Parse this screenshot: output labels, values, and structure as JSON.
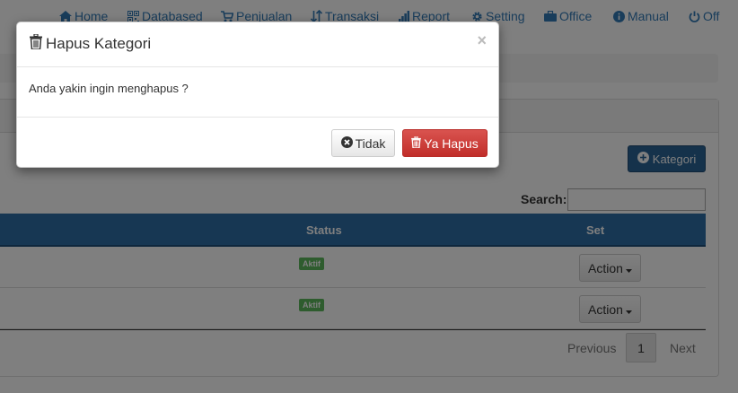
{
  "nav": {
    "items": [
      {
        "label": "Home",
        "icon": "home-icon"
      },
      {
        "label": "Databased",
        "icon": "qrcode-icon"
      },
      {
        "label": "Penjualan",
        "icon": "cart-icon"
      },
      {
        "label": "Transaksi",
        "icon": "sort-icon"
      },
      {
        "label": "Report",
        "icon": "bar-chart-icon"
      },
      {
        "label": "Setting",
        "icon": "gear-icon"
      },
      {
        "label": "Office",
        "icon": "briefcase-icon"
      },
      {
        "label": "Manual",
        "icon": "info-icon"
      },
      {
        "label": "Off",
        "icon": "power-icon"
      }
    ]
  },
  "page": {
    "add_button_label": "Kategori",
    "search_label": "Search:",
    "search_value": "",
    "table": {
      "headers": [
        "Status",
        "Set"
      ],
      "rows": [
        {
          "status": "Aktif",
          "action_label": "Action"
        },
        {
          "status": "Aktif",
          "action_label": "Action"
        }
      ]
    },
    "pagination": {
      "previous": "Previous",
      "current": "1",
      "next": "Next"
    }
  },
  "modal": {
    "title": "Hapus Kategori",
    "close": "×",
    "message": "Anda yakin ingin menghapus ?",
    "cancel_label": "Tidak",
    "confirm_label": "Ya Hapus"
  },
  "colors": {
    "primary": "#2e6ea6",
    "danger": "#d9534f",
    "success": "#5cb85c"
  }
}
